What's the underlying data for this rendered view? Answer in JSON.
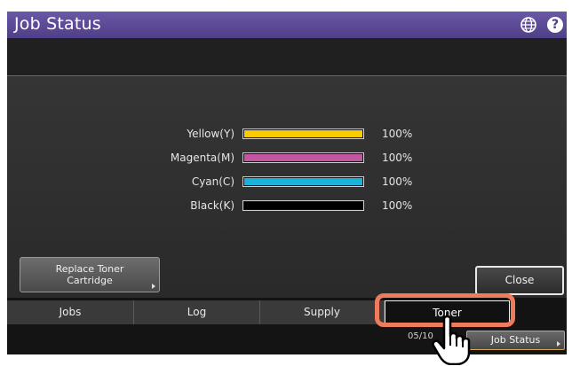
{
  "header": {
    "title": "Job Status",
    "globe_icon": "globe-icon",
    "help_label": "?"
  },
  "toners": [
    {
      "label": "Yellow(Y)",
      "percent": "100%",
      "level": 1.0,
      "color": "#f8cc00"
    },
    {
      "label": "Magenta(M)",
      "percent": "100%",
      "level": 1.0,
      "color": "#c355a2"
    },
    {
      "label": "Cyan(C)",
      "percent": "100%",
      "level": 1.0,
      "color": "#1bb1d9"
    },
    {
      "label": "Black(K)",
      "percent": "100%",
      "level": 1.0,
      "color": "#000000"
    }
  ],
  "buttons": {
    "replace_toner_line1": "Replace Toner",
    "replace_toner_line2": "Cartridge",
    "close": "Close"
  },
  "tabs": [
    {
      "label": "Jobs",
      "active": false
    },
    {
      "label": "Log",
      "active": false
    },
    {
      "label": "Supply",
      "active": false
    },
    {
      "label": "Toner",
      "active": true
    }
  ],
  "footer": {
    "datetime": "05/10",
    "job_status": "Job Status"
  },
  "colors": {
    "titlebar": "#5a4896",
    "highlight": "#ee7b5d"
  },
  "annotation_icon": "hand-pointer-icon"
}
